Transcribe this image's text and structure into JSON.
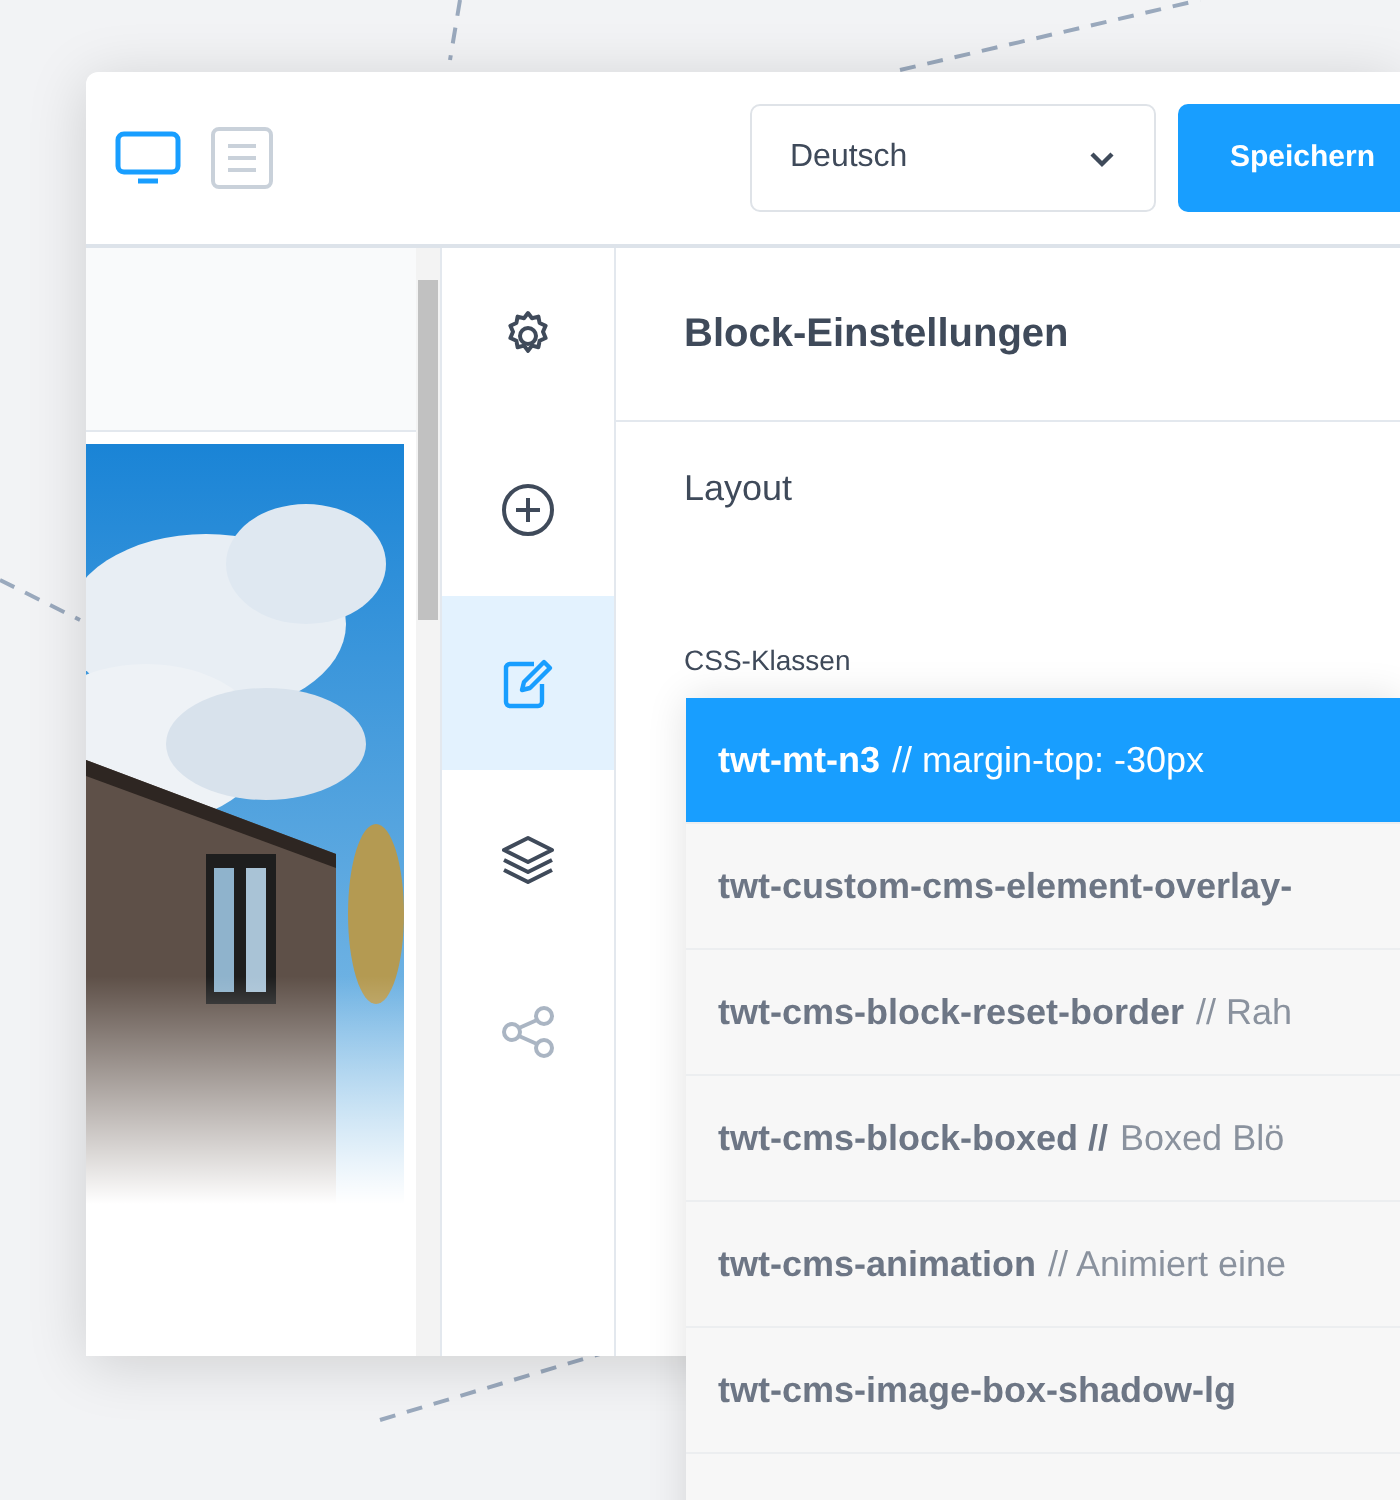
{
  "toolbar": {
    "view_modes": [
      {
        "kind": "desktop",
        "selected": true
      },
      {
        "kind": "list",
        "selected": false
      }
    ],
    "language": {
      "value": "Deutsch"
    },
    "save_button": "Speichern"
  },
  "rail": [
    {
      "kind": "settings",
      "selected": false
    },
    {
      "kind": "add",
      "selected": false
    },
    {
      "kind": "edit",
      "selected": true
    },
    {
      "kind": "layers",
      "selected": false
    },
    {
      "kind": "share",
      "selected": false
    }
  ],
  "panel": {
    "title": "Block-Einstellungen",
    "section": "Layout",
    "field_label": "CSS-Klassen",
    "options": [
      {
        "name": "twt-mt-n3",
        "comment": "// margin-top: -30px",
        "selected": true
      },
      {
        "name": "twt-custom-cms-element-overlay-",
        "selected": false
      },
      {
        "name": "twt-cms-block-reset-border",
        "comment": "// Rah",
        "selected": false
      },
      {
        "name": "twt-cms-block-boxed //",
        "comment": "Boxed Blö",
        "selected": false
      },
      {
        "name": "twt-cms-animation",
        "comment": "// Animiert eine",
        "selected": false
      },
      {
        "name": "twt-cms-image-box-shadow-lg",
        "selected": false
      },
      {
        "selected": false
      }
    ]
  }
}
